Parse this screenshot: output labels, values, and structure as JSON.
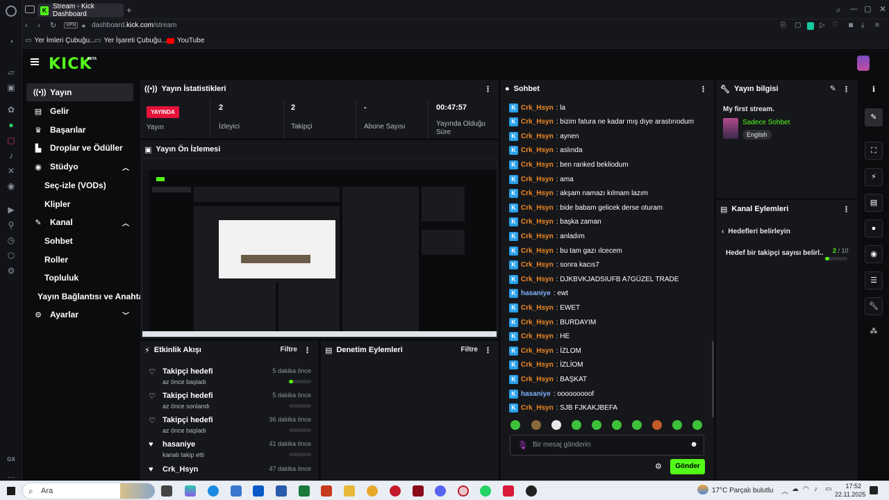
{
  "browser": {
    "tab_title": "Stream - Kick Dashboard",
    "vpn_label": "VPN",
    "url_host": "dashboard.kick.com",
    "url_path": "/stream",
    "bookmarks": [
      "Yer İmleri Çubuğu...",
      "Yer İşareti Çubuğu...",
      "YouTube"
    ]
  },
  "header": {
    "logo": "KICK",
    "beta": "BETA"
  },
  "sidebar": {
    "items": [
      {
        "label": "Yayın",
        "icon": "broadcast-icon"
      },
      {
        "label": "Gelir",
        "icon": "revenue-icon"
      },
      {
        "label": "Başarılar",
        "icon": "trophy-icon"
      },
      {
        "label": "Droplar ve Ödüller",
        "icon": "gift-icon"
      },
      {
        "label": "Stüdyo",
        "icon": "studio-icon"
      },
      {
        "label": "Kanal",
        "icon": "channel-icon"
      },
      {
        "label": "Ayarlar",
        "icon": "gear-icon"
      }
    ],
    "studio_sub": [
      "Seç-izle (VODs)",
      "Klipler"
    ],
    "channel_sub": [
      "Sohbet",
      "Roller",
      "Topluluk",
      "Yayın Bağlantısı ve Anahtarı"
    ]
  },
  "stats": {
    "title": "Yayın İstatistikleri",
    "live_badge": "YAYINDA",
    "live_label": "Yayın",
    "items": [
      {
        "value": "2",
        "label": "İzleyici"
      },
      {
        "value": "2",
        "label": "Takipçi"
      },
      {
        "value": "-",
        "label": "Abone Sayısı"
      },
      {
        "value": "00:47:57",
        "label": "Yayında Olduğu Süre"
      }
    ]
  },
  "preview": {
    "title": "Yayın Ön İzlemesi"
  },
  "events": {
    "title": "Etkinlik Akışı",
    "filter": "Filtre",
    "items": [
      {
        "title": "Takipçi hedefi",
        "sub": "az önce başladı",
        "time": "5 dakika önce",
        "progress": 0.2
      },
      {
        "title": "Takipçi hedefi",
        "sub": "az önce sonlandı",
        "time": "5 dakika önce",
        "progress": 0
      },
      {
        "title": "Takipçi hedefi",
        "sub": "az önce başladı",
        "time": "36 dakika önce",
        "progress": 0
      },
      {
        "title": "hasaniye",
        "sub": "kanalı takip etti",
        "time": "41 dakika önce",
        "progress": 0
      },
      {
        "title": "Crk_Hsyn",
        "sub": "",
        "time": "47 dakika önce",
        "progress": 0
      }
    ]
  },
  "moderation": {
    "title": "Denetim Eylemleri",
    "filter": "Filtre"
  },
  "chat": {
    "title": "Sohbet",
    "messages": [
      {
        "user": "Crk_Hsyn",
        "text": ": la",
        "color": "#f08a24"
      },
      {
        "user": "Crk_Hsyn",
        "text": ": bizim fatura ne kadar mış dıye arastırıodum",
        "color": "#f08a24"
      },
      {
        "user": "Crk_Hsyn",
        "text": ": aynen",
        "color": "#f08a24"
      },
      {
        "user": "Crk_Hsyn",
        "text": ": aslında",
        "color": "#f08a24"
      },
      {
        "user": "Crk_Hsyn",
        "text": ": ben ranked bekliodum",
        "color": "#f08a24"
      },
      {
        "user": "Crk_Hsyn",
        "text": ": ama",
        "color": "#f08a24"
      },
      {
        "user": "Crk_Hsyn",
        "text": ": akşam namazı kılmam lazım",
        "color": "#f08a24"
      },
      {
        "user": "Crk_Hsyn",
        "text": ": bide babam gelicek derse oturam",
        "color": "#f08a24"
      },
      {
        "user": "Crk_Hsyn",
        "text": ": başka zaman",
        "color": "#f08a24"
      },
      {
        "user": "Crk_Hsyn",
        "text": ": anladım",
        "color": "#f08a24"
      },
      {
        "user": "Crk_Hsyn",
        "text": ": bu tam gazı ılcecem",
        "color": "#f08a24"
      },
      {
        "user": "Crk_Hsyn",
        "text": ": sonra kacıs7",
        "color": "#f08a24"
      },
      {
        "user": "Crk_Hsyn",
        "text": ": DJKBVKJADSIUFB A7GÜZEL TRADE",
        "color": "#f08a24"
      },
      {
        "user": "hasaniye",
        "text": ": ewt",
        "color": "#7fb3ff"
      },
      {
        "user": "Crk_Hsyn",
        "text": ": EWET",
        "color": "#f08a24"
      },
      {
        "user": "Crk_Hsyn",
        "text": ": BURDAYIM",
        "color": "#f08a24"
      },
      {
        "user": "Crk_Hsyn",
        "text": ": HE",
        "color": "#f08a24"
      },
      {
        "user": "Crk_Hsyn",
        "text": ": İZLOM",
        "color": "#f08a24"
      },
      {
        "user": "Crk_Hsyn",
        "text": ": İZLİOM",
        "color": "#f08a24"
      },
      {
        "user": "Crk_Hsyn",
        "text": ": BAŞKAT",
        "color": "#f08a24"
      },
      {
        "user": "hasaniye",
        "text": ": ooooooooof",
        "color": "#7fb3ff"
      },
      {
        "user": "Crk_Hsyn",
        "text": ": SJB FJKAKJBEFA",
        "color": "#f08a24"
      }
    ],
    "placeholder": "Bir mesaj gönderin",
    "send": "Gönder"
  },
  "stream_info": {
    "title": "Yayın bilgisi",
    "stream_title": "My first stream.",
    "category": "Sadece Sohbet",
    "language": "English"
  },
  "channel_actions": {
    "title": "Kanal Eylemleri",
    "back_label": "Hedefleri belirleyin",
    "goal_label": "Hedef bir takipçi sayısı belirl...",
    "goal_current": "2",
    "goal_total": "/ 10",
    "goal_progress": 0.2
  },
  "taskbar": {
    "search": "Ara",
    "weather": "17°C  Parçalı bulutlu",
    "time": "17:52",
    "date": "22.11.2025"
  },
  "colors": {
    "accent": "#53fc18",
    "live": "#e5123a",
    "bg": "#0b0c0e",
    "panel": "#16171b"
  }
}
